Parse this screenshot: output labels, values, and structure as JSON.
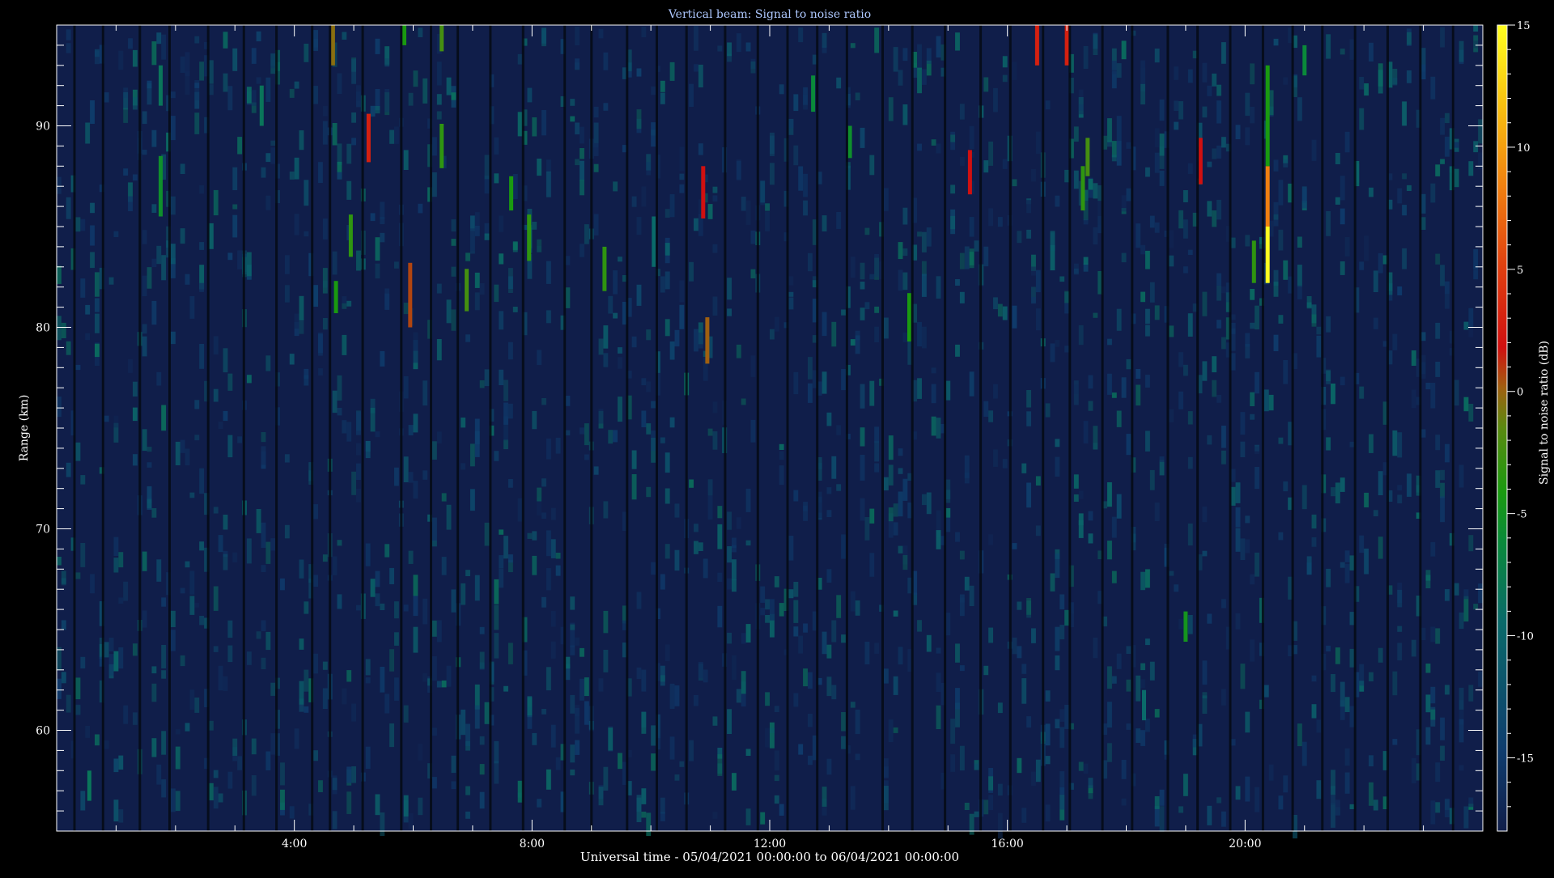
{
  "chart_data": {
    "type": "heatmap",
    "title": "Vertical beam: Signal to noise ratio",
    "xlabel": "Universal time - 05/04/2021 00:00:00 to 06/04/2021 00:00:00",
    "ylabel": "Range (km)",
    "colorbar_label": "Signal to noise ratio (dB)",
    "x_unit": "hours UT",
    "xlim": [
      0,
      24
    ],
    "ylim": [
      55,
      95
    ],
    "clim": [
      -18,
      15
    ],
    "x_ticks": [
      {
        "value": 4,
        "label": "4:00"
      },
      {
        "value": 8,
        "label": "8:00"
      },
      {
        "value": 12,
        "label": "12:00"
      },
      {
        "value": 16,
        "label": "16:00"
      },
      {
        "value": 20,
        "label": "20:00"
      }
    ],
    "y_ticks": [
      {
        "value": 60,
        "label": "60"
      },
      {
        "value": 70,
        "label": "70"
      },
      {
        "value": 80,
        "label": "80"
      },
      {
        "value": 90,
        "label": "90"
      }
    ],
    "colorbar_ticks": [
      {
        "value": 15,
        "label": "15"
      },
      {
        "value": 10,
        "label": "10"
      },
      {
        "value": 5,
        "label": "5"
      },
      {
        "value": 0,
        "label": "0"
      },
      {
        "value": -5,
        "label": "-5"
      },
      {
        "value": -10,
        "label": "-10"
      },
      {
        "value": -15,
        "label": "-15"
      }
    ],
    "colormap": [
      "#101e4a",
      "#0f3d6e",
      "#0a6a6a",
      "#0a8a3a",
      "#1a9a10",
      "#5a8a10",
      "#a06010",
      "#d01010",
      "#e04010",
      "#f08010",
      "#f8c010",
      "#ffff20"
    ],
    "background_snr_db": -17,
    "data_gap_hours": [
      0.3,
      0.78,
      1.4,
      1.9,
      2.55,
      3.15,
      3.7,
      4.3,
      4.6,
      5.15,
      5.8,
      6.3,
      6.75,
      7.3,
      7.85,
      8.55,
      9.0,
      9.6,
      10.1,
      10.6,
      11.25,
      11.8,
      12.3,
      12.8,
      13.3,
      13.9,
      14.4,
      14.95,
      15.55,
      16.05,
      16.6,
      17.05,
      17.6,
      18.1,
      18.7,
      19.2,
      19.75,
      20.3,
      20.8,
      21.3,
      21.85,
      22.4,
      22.95,
      23.5
    ],
    "echoes": [
      {
        "t": 4.65,
        "r0": 93.0,
        "r1": 95.0,
        "snr": -1
      },
      {
        "t": 5.25,
        "r0": 88.2,
        "r1": 90.6,
        "snr": 4
      },
      {
        "t": 4.95,
        "r0": 83.5,
        "r1": 85.6,
        "snr": -5
      },
      {
        "t": 4.7,
        "r0": 80.7,
        "r1": 82.3,
        "snr": -6
      },
      {
        "t": 5.85,
        "r0": 94.0,
        "r1": 95.0,
        "snr": -6
      },
      {
        "t": 6.48,
        "r0": 93.7,
        "r1": 95.0,
        "snr": -4
      },
      {
        "t": 6.48,
        "r0": 87.9,
        "r1": 90.1,
        "snr": -5
      },
      {
        "t": 5.95,
        "r0": 80.0,
        "r1": 83.2,
        "snr": 1
      },
      {
        "t": 6.9,
        "r0": 80.8,
        "r1": 82.9,
        "snr": -4
      },
      {
        "t": 7.65,
        "r0": 85.8,
        "r1": 87.5,
        "snr": -6
      },
      {
        "t": 7.95,
        "r0": 83.3,
        "r1": 85.6,
        "snr": -5
      },
      {
        "t": 9.22,
        "r0": 81.8,
        "r1": 84.0,
        "snr": -5
      },
      {
        "t": 10.88,
        "r0": 85.4,
        "r1": 88.0,
        "snr": 3
      },
      {
        "t": 10.95,
        "r0": 78.2,
        "r1": 80.5,
        "snr": 0
      },
      {
        "t": 12.73,
        "r0": 90.7,
        "r1": 92.5,
        "snr": -9
      },
      {
        "t": 13.35,
        "r0": 88.4,
        "r1": 90.0,
        "snr": -8
      },
      {
        "t": 14.35,
        "r0": 79.3,
        "r1": 81.7,
        "snr": -6
      },
      {
        "t": 15.37,
        "r0": 86.6,
        "r1": 88.8,
        "snr": 3
      },
      {
        "t": 16.5,
        "r0": 93.0,
        "r1": 95.0,
        "snr": 4
      },
      {
        "t": 17.0,
        "r0": 93.0,
        "r1": 95.0,
        "snr": 4
      },
      {
        "t": 17.35,
        "r0": 87.5,
        "r1": 89.4,
        "snr": -4
      },
      {
        "t": 17.27,
        "r0": 85.8,
        "r1": 88.0,
        "snr": -5
      },
      {
        "t": 19.0,
        "r0": 64.4,
        "r1": 65.9,
        "snr": -7
      },
      {
        "t": 19.25,
        "r0": 87.1,
        "r1": 89.4,
        "snr": 3
      },
      {
        "t": 20.15,
        "r0": 82.2,
        "r1": 84.3,
        "snr": -5
      },
      {
        "t": 20.38,
        "r0": 82.2,
        "r1": 85.0,
        "snr": 15
      },
      {
        "t": 20.38,
        "r0": 85.0,
        "r1": 88.0,
        "snr": 9
      },
      {
        "t": 20.38,
        "r0": 88.0,
        "r1": 93.0,
        "snr": -6
      },
      {
        "t": 21.0,
        "r0": 92.5,
        "r1": 94.0,
        "snr": -9
      },
      {
        "t": 1.75,
        "r0": 85.5,
        "r1": 88.5,
        "snr": -8
      },
      {
        "t": 1.75,
        "r0": 91.0,
        "r1": 93.0,
        "snr": -11
      },
      {
        "t": 3.45,
        "r0": 90.0,
        "r1": 92.0,
        "snr": -11
      },
      {
        "t": 0.55,
        "r0": 56.5,
        "r1": 58.0,
        "snr": -11
      },
      {
        "t": 10.05,
        "r0": 83.0,
        "r1": 85.5,
        "snr": -12
      },
      {
        "t": 18.3,
        "r0": 60.5,
        "r1": 62.0,
        "snr": -12
      }
    ]
  }
}
